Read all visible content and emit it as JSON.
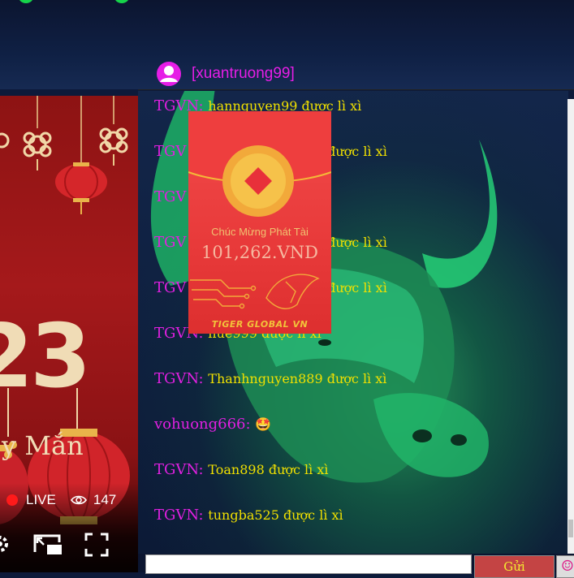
{
  "header": {
    "username": "[xuantruong99]"
  },
  "video": {
    "year_fragment": "23",
    "subtitle_fragment": "y Mắn",
    "live_label": "LIVE",
    "viewer_count": "147"
  },
  "chat": {
    "messages": [
      {
        "name": "TGVN:",
        "text": "hannguyen99 được lì xì"
      },
      {
        "name": "TGV",
        "text": "được lì xì"
      },
      {
        "name": "TGV",
        "text": ""
      },
      {
        "name": "TGV",
        "text": "được lì xì"
      },
      {
        "name": "TGV",
        "text": "được lì xì"
      },
      {
        "name": "TGVN:",
        "text": "hue999 được lì xì"
      },
      {
        "name": "TGVN:",
        "text": "Thanhnguyen889 được lì xì"
      },
      {
        "name": "vohuong666:",
        "text": "🤩"
      },
      {
        "name": "TGVN:",
        "text": "Toan898 được lì xì"
      },
      {
        "name": "TGVN:",
        "text": "tungba525 được lì xì"
      }
    ]
  },
  "envelope": {
    "title": "Chúc Mừng Phát Tài",
    "amount": "101,262.VND",
    "brand": "TIGER GLOBAL VN"
  },
  "composer": {
    "input_value": "",
    "send_label": "Gửi",
    "emoji_label": "☺"
  },
  "colors": {
    "username": "#e61ee6",
    "message": "#f0e000",
    "envelope": "#e83a3a"
  }
}
